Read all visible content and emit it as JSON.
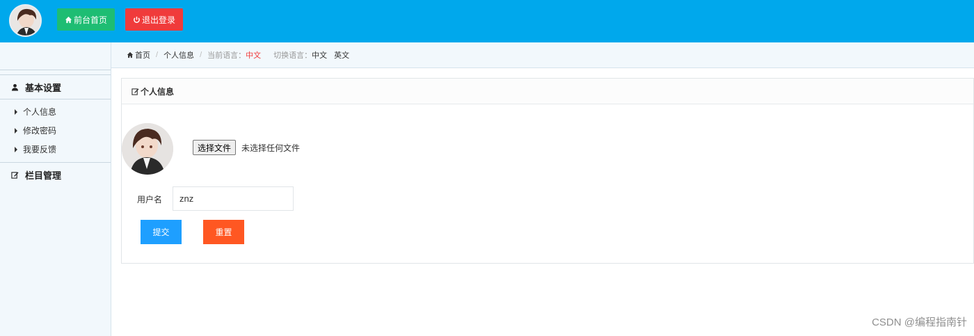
{
  "topbar": {
    "home_label": "前台首页",
    "logout_label": "退出登录",
    "colors": {
      "bar": "#00a8ec",
      "home": "#1ebd73",
      "logout": "#f03b3b"
    }
  },
  "sidebar": {
    "groups": [
      {
        "title": "基本设置",
        "icon": "user-icon",
        "items": [
          {
            "label": "个人信息"
          },
          {
            "label": "修改密码"
          },
          {
            "label": "我要反馈"
          }
        ]
      },
      {
        "title": "栏目管理",
        "icon": "edit-icon",
        "items": []
      }
    ]
  },
  "breadcrumb": {
    "home": "首页",
    "current": "个人信息",
    "lang_prefix": "当前语言：",
    "lang_current": "中文",
    "switch_prefix": "切换语言：",
    "lang_options": [
      "中文",
      "英文"
    ]
  },
  "panel": {
    "title": "个人信息",
    "file_button": "选择文件",
    "file_status": "未选择任何文件",
    "username_label": "用户名",
    "username_value": "znz",
    "submit_label": "提交",
    "reset_label": "重置"
  },
  "watermark": "CSDN @编程指南针"
}
